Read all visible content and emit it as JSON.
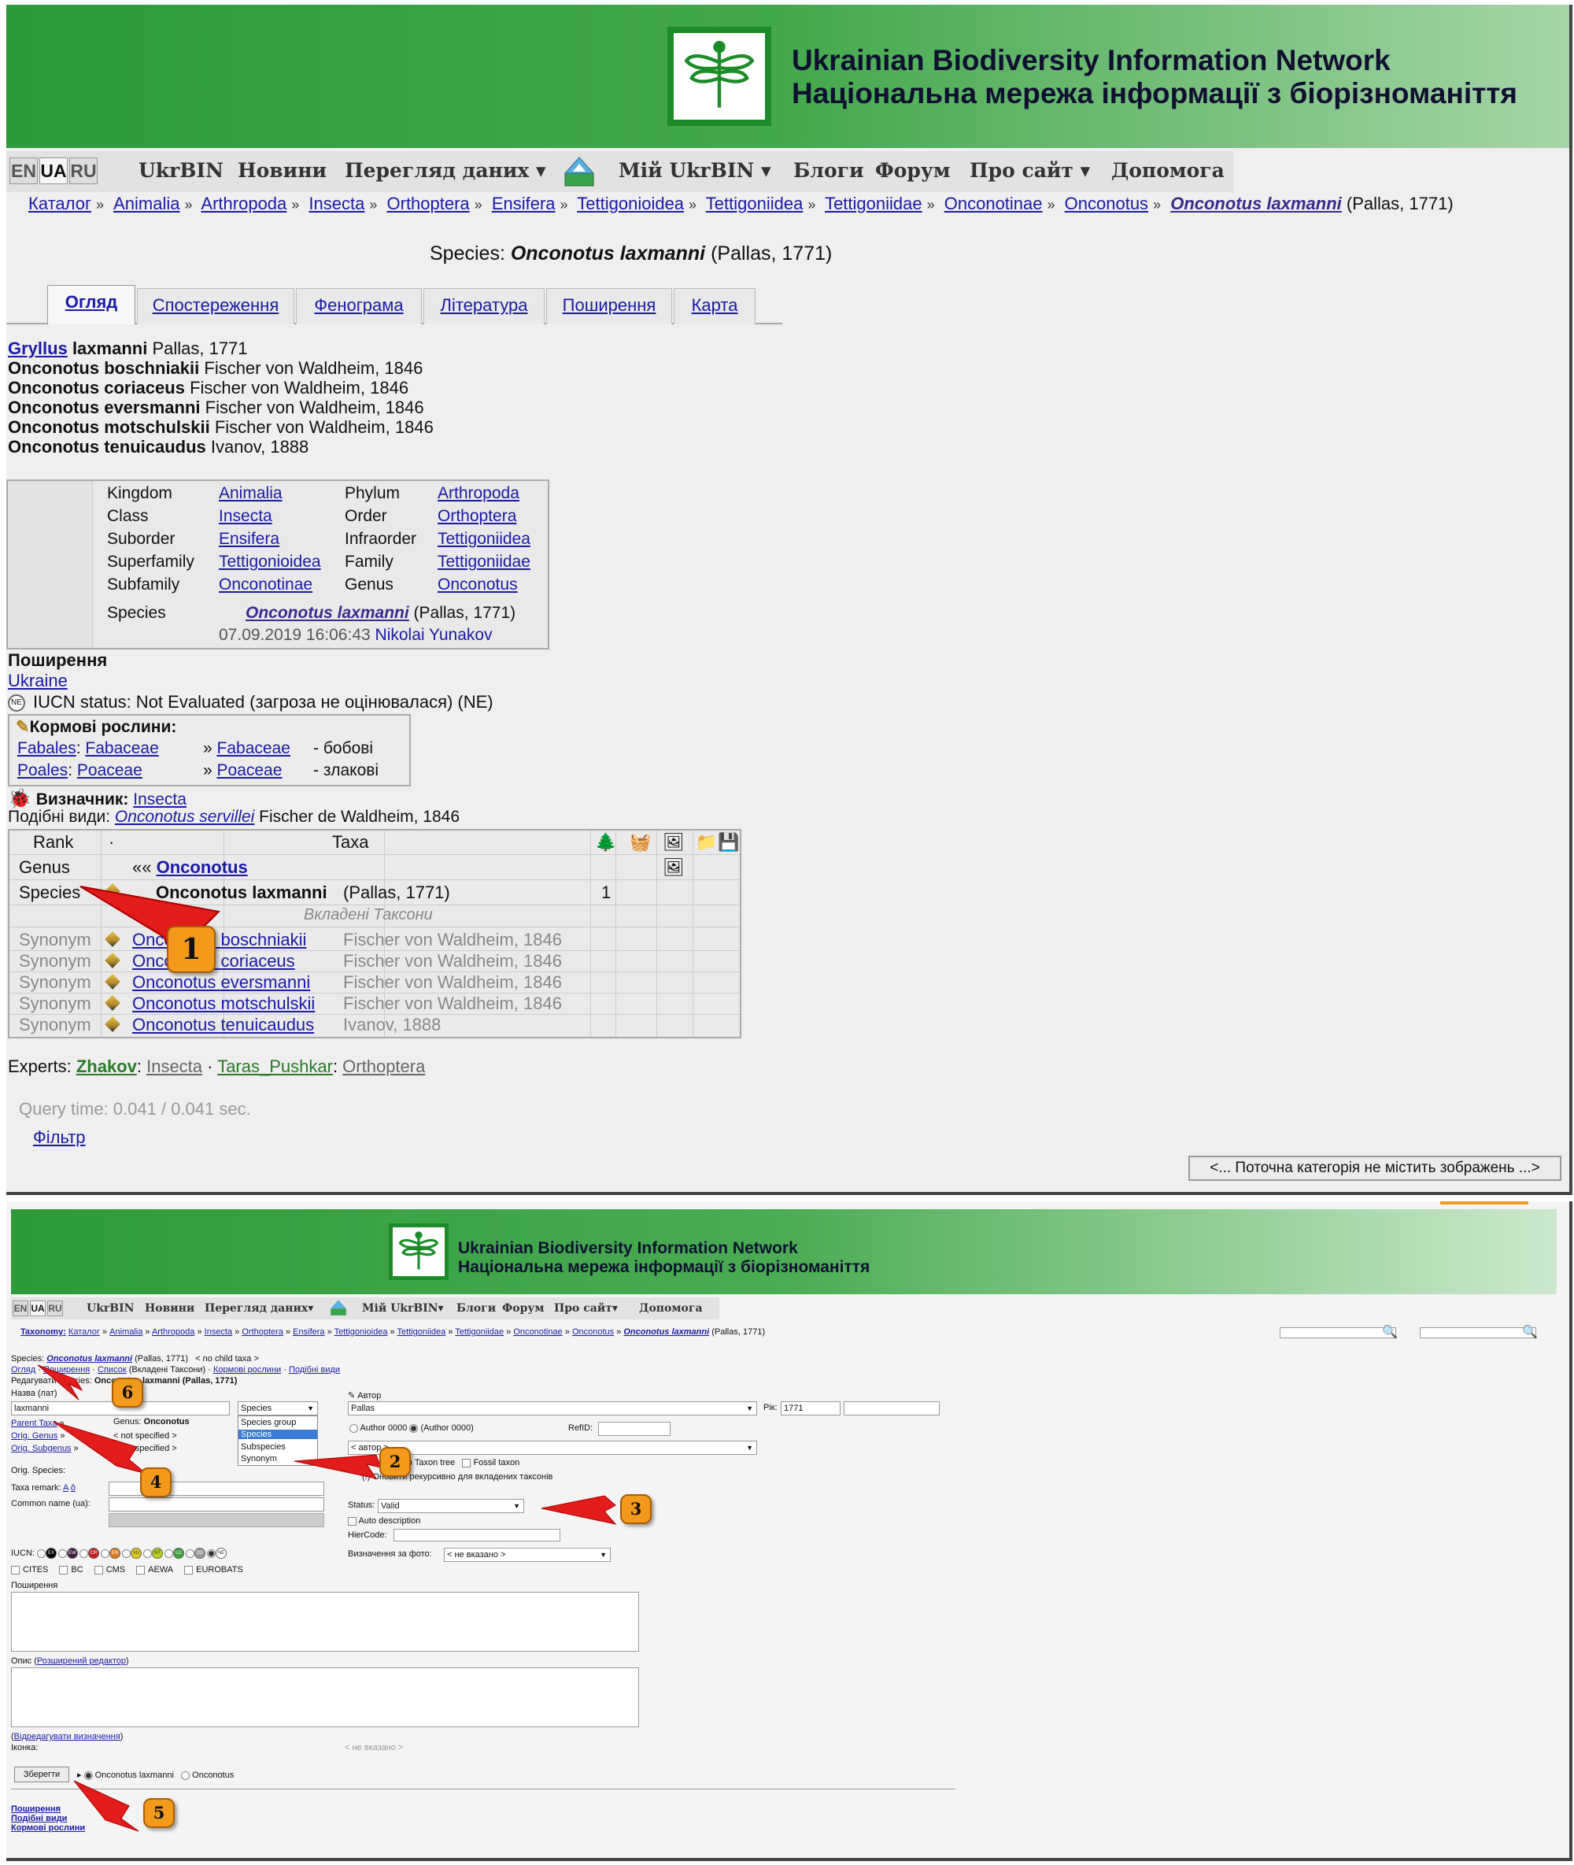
{
  "panelA": {
    "banner": {
      "title_en": "Ukrainian Biodiversity Information Network",
      "title_ua": "Національна мережа інформації з біорізноманіття"
    },
    "nav": {
      "langs": [
        "EN",
        "UA",
        "RU"
      ],
      "items": [
        "UkrBIN",
        "Новини",
        "Перегляд даних",
        "Мій UkrBIN",
        "Блоги",
        "Форум",
        "Про сайт",
        "Допомога"
      ]
    },
    "breadcrumbs": [
      "Каталог",
      "Animalia",
      "Arthropoda",
      "Insecta",
      "Orthoptera",
      "Ensifera",
      "Tettigonioidea",
      "Tettigoniidea",
      "Tettigoniidae",
      "Onconotinae",
      "Onconotus",
      "Onconotus laxmanni"
    ],
    "breadcrumb_author": "(Pallas, 1771)",
    "title": {
      "prefix": "Species:",
      "name": "Onconotus laxmanni",
      "author": "(Pallas, 1771)"
    },
    "tabs": [
      "Огляд",
      "Спостереження",
      "Фенограма",
      "Література",
      "Поширення",
      "Карта"
    ],
    "synonyms": [
      {
        "genus": "Gryllus",
        "epithet": "laxmanni",
        "author": "Pallas, 1771"
      },
      {
        "name": "Onconotus boschniakii",
        "author": "Fischer von Waldheim, 1846"
      },
      {
        "name": "Onconotus coriaceus",
        "author": "Fischer von Waldheim, 1846"
      },
      {
        "name": "Onconotus eversmanni",
        "author": "Fischer von Waldheim, 1846"
      },
      {
        "name": "Onconotus motschulskii",
        "author": "Fischer von Waldheim, 1846"
      },
      {
        "name": "Onconotus tenuicaudus",
        "author": "Ivanov, 1888"
      }
    ],
    "classification": {
      "rows": [
        {
          "l1": "Kingdom",
          "v1": "Animalia",
          "l2": "Phylum",
          "v2": "Arthropoda"
        },
        {
          "l1": "Class",
          "v1": "Insecta",
          "l2": "Order",
          "v2": "Orthoptera"
        },
        {
          "l1": "Suborder",
          "v1": "Ensifera",
          "l2": "Infraorder",
          "v2": "Tettigoniidea"
        },
        {
          "l1": "Superfamily",
          "v1": "Tettigonioidea",
          "l2": "Family",
          "v2": "Tettigoniidae"
        },
        {
          "l1": "Subfamily",
          "v1": "Onconotinae",
          "l2": "Genus",
          "v2": "Onconotus"
        }
      ],
      "species_label": "Species",
      "species_name": "Onconotus laxmanni",
      "species_author": "(Pallas, 1771)",
      "date": "07.09.2019 16:06:43",
      "user": "Nikolai Yunakov"
    },
    "distribution_header": "Поширення",
    "distribution_link": "Ukraine",
    "iucn_text": "IUCN status: Not Evaluated (загроза не оцінювалася) (NE)",
    "iucn_icon": "NE",
    "food_plants": {
      "header": "Кормові рослини:",
      "rows": [
        {
          "order": "Fabales",
          "fam": "Fabaceae",
          "target": "Fabaceae",
          "note": "- бобові"
        },
        {
          "order": "Poales",
          "fam": "Poaceae",
          "target": "Poaceae",
          "note": "- злакові"
        }
      ]
    },
    "key": {
      "label": "Визначник:",
      "link": "Insecta"
    },
    "similar": {
      "label": "Подібні види:",
      "name": "Onconotus servillei",
      "author": "Fischer de Waldheim, 1846"
    },
    "taxa_table": {
      "headers": {
        "rank": "Rank",
        "dot": "·",
        "taxa": "Taxa"
      },
      "genus": {
        "rank": "Genus",
        "arrow": "««",
        "name": "Onconotus"
      },
      "species": {
        "rank": "Species",
        "name": "Onconotus laxmanni",
        "author": "(Pallas, 1771)",
        "count": "1"
      },
      "nested": "Вкладені Таксони",
      "synonyms": [
        {
          "rank": "Synonym",
          "name": "Onconotus boschniakii",
          "author": "Fischer von Waldheim, 1846"
        },
        {
          "rank": "Synonym",
          "name": "Onconotus coriaceus",
          "author": "Fischer von Waldheim, 1846"
        },
        {
          "rank": "Synonym",
          "name": "Onconotus eversmanni",
          "author": "Fischer von Waldheim, 1846"
        },
        {
          "rank": "Synonym",
          "name": "Onconotus motschulskii",
          "author": "Fischer von Waldheim, 1846"
        },
        {
          "rank": "Synonym",
          "name": "Onconotus tenuicaudus",
          "author": "Ivanov, 1888"
        }
      ]
    },
    "experts": {
      "label": "Experts:",
      "e1": "Zhakov",
      "t1": "Insecta",
      "e2": "Taras_Pushkar",
      "t2": "Orthoptera"
    },
    "query_time": "Query time: 0.041 / 0.041 sec.",
    "filter": "Фільтр",
    "no_images": "<... Поточна категорія не містить зображень ...>",
    "badge1": "1"
  },
  "panelB": {
    "banner": {
      "title_en": "Ukrainian Biodiversity Information Network",
      "title_ua": "Національна мережа інформації з біорізноманіття"
    },
    "nav": {
      "langs": [
        "EN",
        "UA",
        "RU"
      ],
      "items": [
        "UkrBIN",
        "Новини",
        "Перегляд даних",
        "Мій UkrBIN",
        "Блоги",
        "Форум",
        "Про сайт",
        "Допомога"
      ]
    },
    "crumbs": [
      "Taxonomy:",
      "Каталог",
      "Animalia",
      "Arthropoda",
      "Insecta",
      "Orthoptera",
      "Ensifera",
      "Tettigonioidea",
      "Tettigoniidea",
      "Tettigoniidae",
      "Onconotinae",
      "Onconotus",
      "Onconotus laxmanni"
    ],
    "crumb_author": "(Pallas, 1771)",
    "species_line": {
      "label": "Species:",
      "name": "Onconotus laxmanni",
      "author": "(Pallas, 1771)",
      "extra": "< no child taxa >"
    },
    "links_line": [
      "Огляд",
      "Поширення",
      "Список",
      "(Вкладені Таксони)",
      "Кормові рослини",
      "Подібні види"
    ],
    "edit_prefix": "Редагувати Species:",
    "edit_name": "Onconotus laxmanni (Pallas, 1771)",
    "name_label": "Назва (лат)",
    "name_value": "laxmanni",
    "rank_select": "Species",
    "rank_options": [
      "Species group",
      "Species",
      "Subspecies",
      "Synonym"
    ],
    "author_label": "Автор",
    "author_value": "Pallas",
    "year_label": "Рік:",
    "year_value": "1771",
    "genus_label": "Genus:",
    "genus_value": "Onconotus",
    "parent_taxa": "Parent Taxa",
    "orig_genus": "Orig. Genus",
    "orig_subgenus": "Orig. Subgenus",
    "not_specified": "< not specified >",
    "author0000": "Author 0000",
    "author0000b": "(Author 0000)",
    "refid": "RefID:",
    "avtor_sel": "< автор >",
    "in_tree": "в Taxon tree",
    "fossil": "Fossil taxon",
    "recursive": "(!) Оновити рекурсивно для вкладених таксонів",
    "orig_species": "Orig. Species:",
    "taxa_remark": "Taxa remark:",
    "common_name": "Common name (ua):",
    "status_label": "Status:",
    "status_value": "Valid",
    "auto_desc": "Auto description",
    "hiercode": "HierCode:",
    "iucn_label": "IUCN:",
    "iucn_codes": [
      "EX",
      "EW",
      "CR",
      "EN",
      "VU",
      "NT",
      "LC",
      "DD",
      "NE"
    ],
    "photo_label": "Визначення за фото:",
    "photo_value": "< не вказано >",
    "conventions": [
      "CITES",
      "BC",
      "CMS",
      "AEWA",
      "EUROBATS"
    ],
    "dist_label": "Поширення",
    "desc_label": "Опис",
    "desc_link": "Розширений редактор",
    "edit_ids": "Відредагувати визначення",
    "icon_label": "Іконка:",
    "icon_value": "< не вказано >",
    "save": "Зберегти",
    "radio1": "Onconotus laxmanni",
    "radio2": "Onconotus",
    "bottom_links": [
      "Поширення",
      "Подібні види",
      "Кормові рослини"
    ],
    "badges": [
      "6",
      "4",
      "2",
      "3",
      "5"
    ]
  }
}
